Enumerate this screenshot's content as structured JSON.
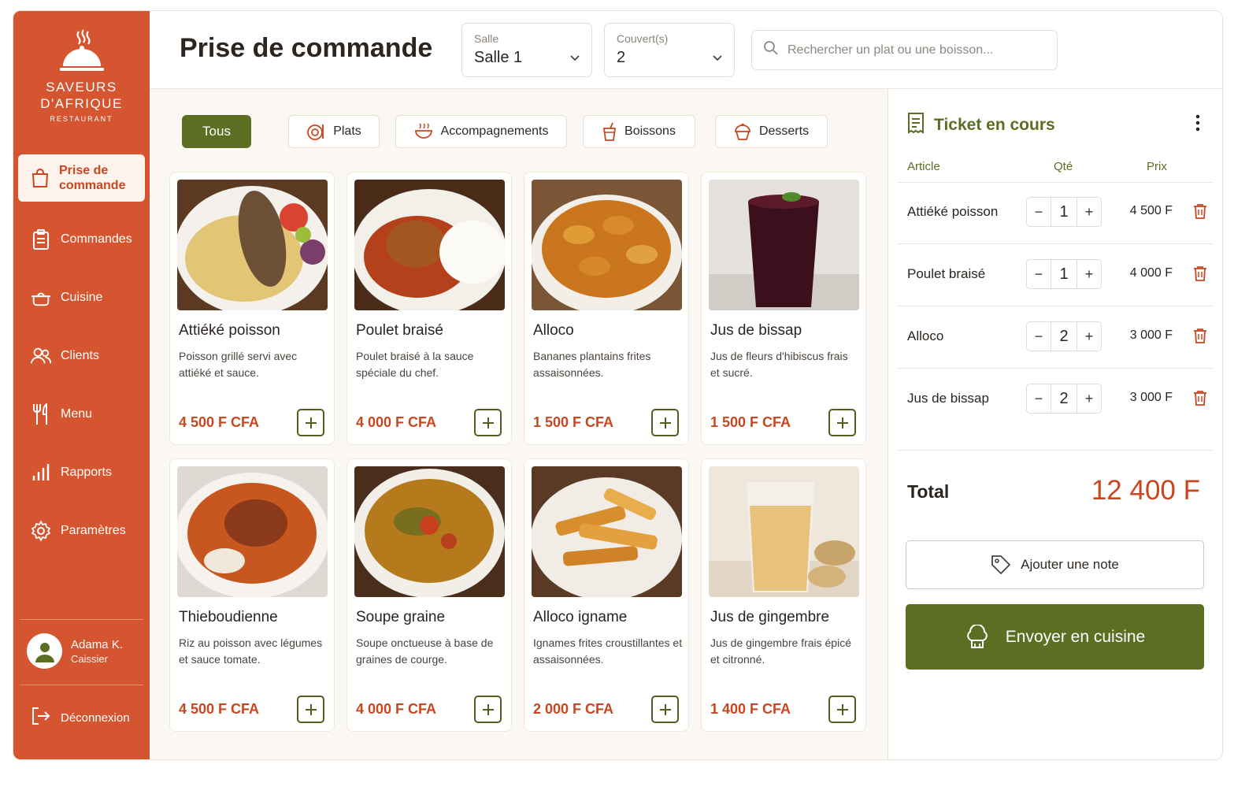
{
  "brand": {
    "name_line1": "SAVEURS",
    "name_line2": "D'AFRIQUE",
    "sub": "RESTAURANT"
  },
  "sidebar": {
    "items": [
      {
        "label": "Prise de commande",
        "icon": "bag-icon",
        "active": true
      },
      {
        "label": "Commandes",
        "icon": "clipboard-icon"
      },
      {
        "label": "Cuisine",
        "icon": "pot-icon"
      },
      {
        "label": "Clients",
        "icon": "users-icon"
      },
      {
        "label": "Menu",
        "icon": "cutlery-icon"
      },
      {
        "label": "Rapports",
        "icon": "bar-chart-icon"
      },
      {
        "label": "Paramètres",
        "icon": "gear-icon"
      }
    ],
    "user": {
      "name": "Adama K.",
      "role": "Caissier"
    },
    "logout": "Déconnexion"
  },
  "header": {
    "title": "Prise de commande",
    "salle": {
      "label": "Salle",
      "value": "Salle 1"
    },
    "couverts": {
      "label": "Couvert(s)",
      "value": "2"
    },
    "search_placeholder": "Rechercher un plat ou une boisson..."
  },
  "filters": [
    "Tous",
    "Plats",
    "Accompagnements",
    "Boissons",
    "Desserts"
  ],
  "products": [
    {
      "name": "Attiéké poisson",
      "desc": "Poisson grillé servi avec attiéké et sauce.",
      "price": "4 500 F CFA"
    },
    {
      "name": "Poulet braisé",
      "desc": "Poulet braisé à la sauce spéciale du chef.",
      "price": "4 000 F CFA"
    },
    {
      "name": "Alloco",
      "desc": "Bananes plantains frites assaisonnées.",
      "price": "1 500 F CFA"
    },
    {
      "name": "Jus de bissap",
      "desc": "Jus de fleurs d'hibiscus frais et sucré.",
      "price": "1 500 F CFA"
    },
    {
      "name": "Thieboudienne",
      "desc": "Riz au poisson avec légumes et sauce tomate.",
      "price": "4 500 F CFA"
    },
    {
      "name": "Soupe graine",
      "desc": "Soupe onctueuse à base de graines de courge.",
      "price": "4 000 F CFA"
    },
    {
      "name": "Alloco igname",
      "desc": "Ignames frites croustillantes et assaisonnées.",
      "price": "2 000 F CFA"
    },
    {
      "name": "Jus de gingembre",
      "desc": "Jus de gingembre frais épicé et citronné.",
      "price": "1 400 F CFA"
    }
  ],
  "ticket": {
    "title": "Ticket en cours",
    "headers": {
      "article": "Article",
      "qty": "Qté",
      "price": "Prix"
    },
    "lines": [
      {
        "article": "Attiéké poisson",
        "qty": "1",
        "price": "4 500 F"
      },
      {
        "article": "Poulet braisé",
        "qty": "1",
        "price": "4 000 F"
      },
      {
        "article": "Alloco",
        "qty": "2",
        "price": "3 000 F"
      },
      {
        "article": "Jus de bissap",
        "qty": "2",
        "price": "3 000 F"
      }
    ],
    "total_label": "Total",
    "total_value": "12 400 F",
    "note_button": "Ajouter une note",
    "send_button": "Envoyer en cuisine"
  },
  "colors": {
    "brand": "#d4552f",
    "accent_green": "#5b6e22",
    "price": "#c9461f"
  }
}
